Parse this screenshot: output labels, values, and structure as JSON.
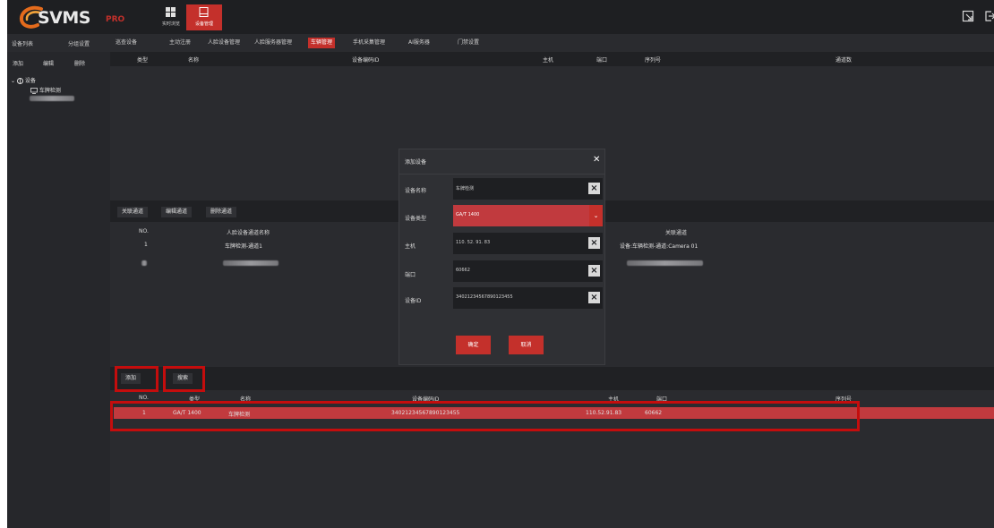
{
  "brand": {
    "name": "SVMS",
    "suffix": "PRO",
    "accent": "#c4302b"
  },
  "modules": [
    {
      "label": "实时浏览",
      "icon": "grid-icon"
    },
    {
      "label": "设备管理",
      "icon": "device-icon"
    }
  ],
  "left_tabs": [
    "设备列表",
    "分组设置"
  ],
  "nav_tabs": [
    "巡查设备",
    "主动注册",
    "人脸设备管理",
    "人脸服务器管理",
    "车辆管理",
    "手机采集管理",
    "AI服务器",
    "门禁设置"
  ],
  "active_nav": "车辆管理",
  "left_panel": {
    "buttons": [
      "添加",
      "编辑",
      "删除"
    ],
    "tree": {
      "root": "设备",
      "child": "车牌检测"
    }
  },
  "top_table": {
    "headers": [
      "类型",
      "名称",
      "设备编码ID",
      "主机",
      "端口",
      "序列号",
      "通道数"
    ]
  },
  "channel_toolbar": [
    "关联通道",
    "编辑通道",
    "删除通道"
  ],
  "channel_table": {
    "headers": [
      "NO.",
      "人脸设备通道名称",
      "关联通道"
    ],
    "rows": [
      {
        "no": "1",
        "name": "车牌检测-通道1",
        "linked": "设备:车辆检测-通道:Camera 01"
      }
    ]
  },
  "bottom_toolbar": [
    "添加",
    "搜索"
  ],
  "bottom_table": {
    "headers": [
      "NO.",
      "类型",
      "名称",
      "设备编码ID",
      "主机",
      "端口",
      "序列号"
    ],
    "rows": [
      {
        "no": "1",
        "type": "GA/T 1400",
        "name": "车牌检测",
        "id": "34021234567890123455",
        "host": "110.52.91.83",
        "port": "60662",
        "serial": ""
      }
    ]
  },
  "dialog": {
    "title": "添加设备",
    "close": "✕",
    "fields": [
      {
        "label": "设备名称",
        "value": "车牌检测"
      },
      {
        "label": "设备类型",
        "value": "GA/T 1400"
      },
      {
        "label": "主机",
        "value": "110. 52. 91. 83"
      },
      {
        "label": "端口",
        "value": "60662"
      },
      {
        "label": "设备ID",
        "value": "34021234567890123455"
      }
    ],
    "confirm": "确定",
    "cancel": "取消"
  }
}
